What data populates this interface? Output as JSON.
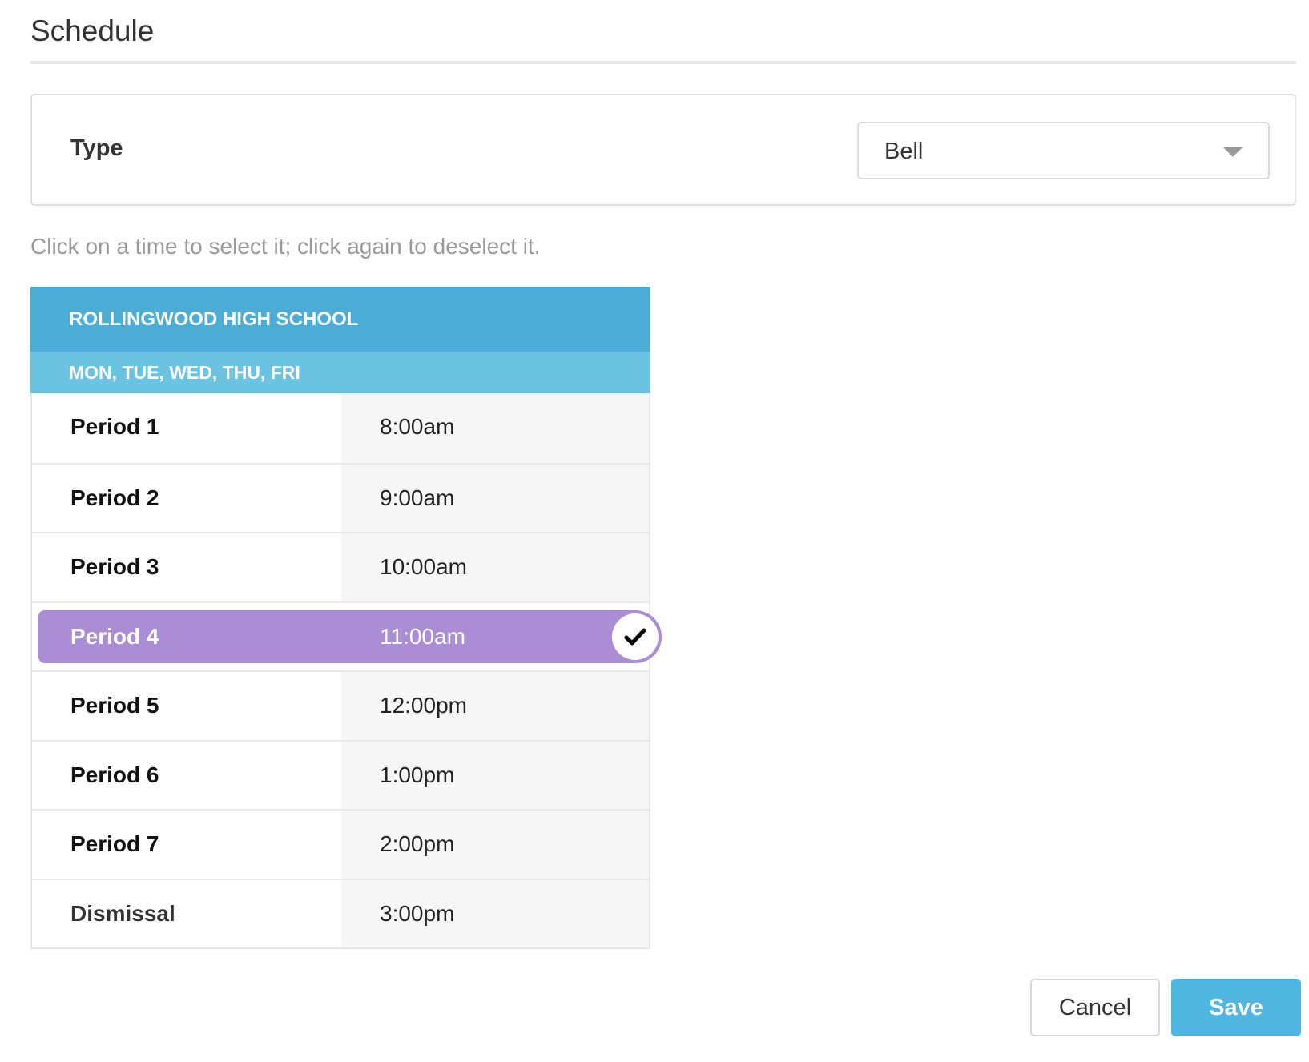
{
  "header": {
    "title": "Schedule"
  },
  "type_panel": {
    "label": "Type",
    "selected_value": "Bell",
    "caret_icon": "chevron-down-icon"
  },
  "instructions": "Click on a time to select it; click again to deselect it.",
  "schedule": {
    "school_name": "ROLLINGWOOD HIGH SCHOOL",
    "days": "MON, TUE, WED, THU, FRI",
    "rows": [
      {
        "name": "Period 1",
        "time": "8:00am",
        "selected": false
      },
      {
        "name": "Period 2",
        "time": "9:00am",
        "selected": false
      },
      {
        "name": "Period 3",
        "time": "10:00am",
        "selected": false
      },
      {
        "name": "Period 4",
        "time": "11:00am",
        "selected": true
      },
      {
        "name": "Period 5",
        "time": "12:00pm",
        "selected": false
      },
      {
        "name": "Period 6",
        "time": "1:00pm",
        "selected": false
      },
      {
        "name": "Period 7",
        "time": "2:00pm",
        "selected": false
      },
      {
        "name": "Dismissal",
        "time": "3:00pm",
        "selected": false
      }
    ],
    "selected_icon": "checkmark-icon"
  },
  "actions": {
    "cancel_label": "Cancel",
    "save_label": "Save"
  },
  "colors": {
    "school_header": "#4badd6",
    "days_header": "#6ac4e1",
    "selected_row": "#ab8dd6",
    "save_button": "#4fb6e0"
  }
}
